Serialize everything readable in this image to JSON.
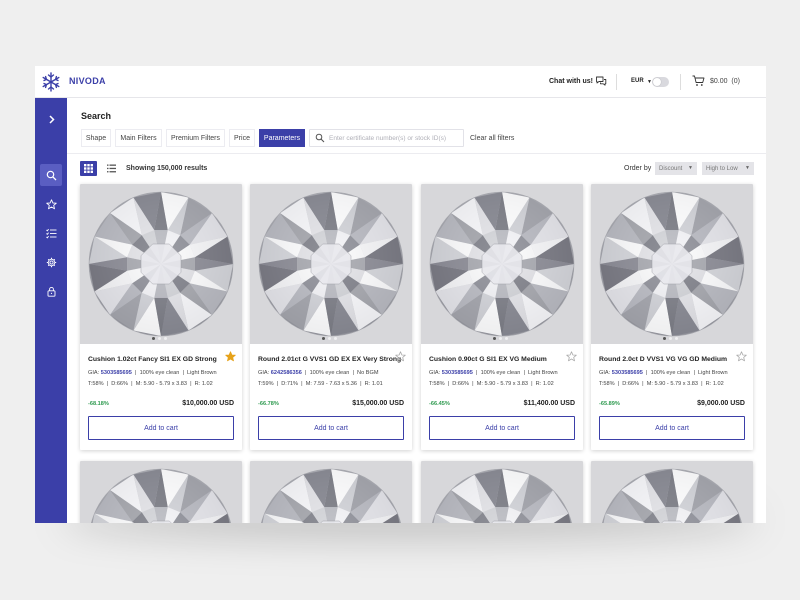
{
  "app": {
    "brand": "NIVODA"
  },
  "header": {
    "chat_label": "Chat with us!",
    "currency": "EUR",
    "cart_total": "$0.00",
    "cart_count": "(0)"
  },
  "search": {
    "title": "Search",
    "tabs": [
      "Shape",
      "Main Filters",
      "Premium Filters",
      "Price",
      "Parameters"
    ],
    "active_tab": "Parameters",
    "placeholder": "Enter certificate number(s) or stock ID(s)",
    "clear_label": "Clear all filters"
  },
  "results": {
    "count_label": "Showing 150,000 results",
    "order_label": "Order by",
    "order_field": "Discount",
    "order_direction": "High to Low"
  },
  "products": [
    {
      "title": "Cushion 1.02ct Fancy SI1 EX GD Strong",
      "gia_label": "GIA:",
      "gia": "5303585695",
      "clarity_note": "100% eye clean",
      "tint": "Light Brown",
      "table": "T:58%",
      "depth": "D:66%",
      "measurements": "M: 5.90 - 5.79 x 3.83",
      "ratio": "R: 1.02",
      "discount": "-68.18%",
      "price": "$10,000.00 USD",
      "favorited": true,
      "button": "Add to cart"
    },
    {
      "title": "Round 2.01ct G VVS1 GD EX EX Very Strong",
      "gia_label": "GIA:",
      "gia": "6242586356",
      "clarity_note": "100% eye clean",
      "tint": "No BGM",
      "table": "T:59%",
      "depth": "D:71%",
      "measurements": "M: 7.59 - 7.63 x 5.36",
      "ratio": "R: 1.01",
      "discount": "-66.78%",
      "price": "$15,000.00 USD",
      "favorited": false,
      "button": "Add to cart"
    },
    {
      "title": "Cushion 0.90ct G SI1 EX VG Medium",
      "gia_label": "GIA:",
      "gia": "5303585695",
      "clarity_note": "100% eye clean",
      "tint": "Light Brown",
      "table": "T:58%",
      "depth": "D:66%",
      "measurements": "M: 5.90 - 5.79 x 3.83",
      "ratio": "R: 1.02",
      "discount": "-66.45%",
      "price": "$11,400.00 USD",
      "favorited": false,
      "button": "Add to cart"
    },
    {
      "title": "Round 2.0ct D VVS1 VG VG GD Medium",
      "gia_label": "GIA:",
      "gia": "5303585695",
      "clarity_note": "100% eye clean",
      "tint": "Light Brown",
      "table": "T:58%",
      "depth": "D:66%",
      "measurements": "M: 5.90 - 5.79 x 3.83",
      "ratio": "R: 1.02",
      "discount": "-65.89%",
      "price": "$9,000.00 USD",
      "favorited": false,
      "button": "Add to cart"
    }
  ],
  "colors": {
    "brand": "#3b3fa8",
    "discount_green": "#2e9a4f",
    "favorite_gold": "#e6a21a"
  },
  "icons": {
    "sidebar": [
      "chevron-right-icon",
      "search-icon",
      "star-icon",
      "checklist-icon",
      "gear-icon",
      "lock-icon"
    ],
    "header": [
      "snowflake-logo-icon",
      "chat-icon",
      "cart-icon"
    ]
  }
}
